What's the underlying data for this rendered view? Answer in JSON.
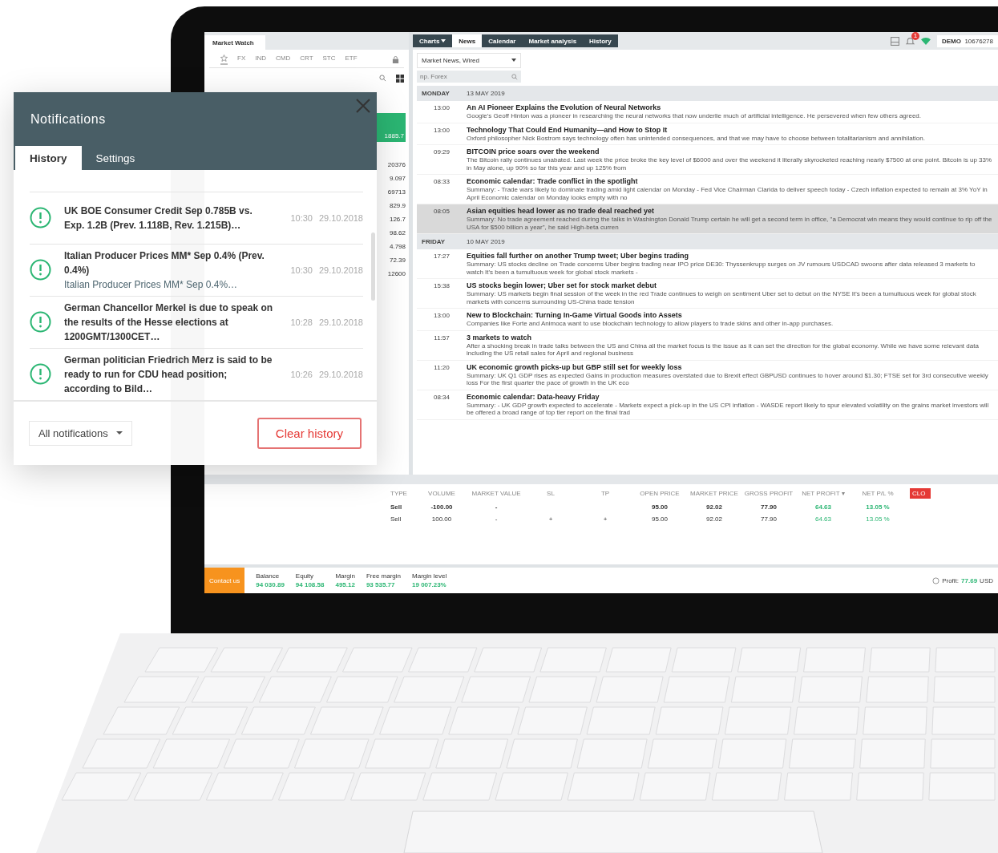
{
  "market_watch": {
    "tab": "Market Watch",
    "categories": [
      {
        "kind": "star",
        "selected": true
      },
      {
        "kind": "text",
        "label": "FX",
        "selected": false
      },
      {
        "kind": "text",
        "label": "IND",
        "selected": false
      },
      {
        "kind": "text",
        "label": "CMD",
        "selected": false
      },
      {
        "kind": "text",
        "label": "CRT",
        "selected": false
      },
      {
        "kind": "text",
        "label": "STC",
        "selected": false
      },
      {
        "kind": "text",
        "label": "ETF",
        "selected": false
      }
    ],
    "buy_price": "1885.7",
    "prices": [
      "20376",
      "9.097",
      "69713",
      "829.9",
      "126.7",
      "98.62",
      "4.798",
      "72.39",
      "12600"
    ]
  },
  "top_tabs": [
    {
      "label": "Charts",
      "dropdown": true,
      "selected": false
    },
    {
      "label": "News",
      "dropdown": false,
      "selected": true
    },
    {
      "label": "Calendar",
      "dropdown": false,
      "selected": false
    },
    {
      "label": "Market analysis",
      "dropdown": false,
      "selected": false
    },
    {
      "label": "History",
      "dropdown": false,
      "selected": false
    }
  ],
  "account": {
    "notification_count": "1",
    "mode": "DEMO",
    "number": "10676278"
  },
  "news": {
    "source_filter": "Market News, Wired",
    "search": {
      "placeholder": "np. Forex"
    },
    "days": [
      {
        "weekday": "MONDAY",
        "date": "13 MAY 2019",
        "items": [
          {
            "time": "13:00",
            "title": "An AI Pioneer Explains the Evolution of Neural Networks",
            "summary": "Google's Geoff Hinton was a pioneer in researching the neural networks that now underlie much of artificial intelligence. He persevered when few others agreed.",
            "selected": false
          },
          {
            "time": "13:00",
            "title": "Technology That Could End Humanity—and How to Stop It",
            "summary": "Oxford philosopher Nick Bostrom says technology often has unintended consequences, and that we may have to choose between totalitarianism and annihilation.",
            "selected": false
          },
          {
            "time": "09:29",
            "title": "BITCOIN price soars over the weekend",
            "summary": "The Bitcoin rally continues unabated. Last week the price broke the key level of $6000 and over the weekend it literally skyrocketed reaching nearly $7500 at one point. Bitcoin is up 33% in May alone, up 90% so far this year and up 125% from",
            "selected": false
          },
          {
            "time": "08:33",
            "title": "Economic calendar: Trade conflict in the spotlight",
            "summary": "Summary: - Trade wars likely to dominate trading amid light calendar on Monday - Fed Vice Chairman Clarida to deliver speech today - Czech inflation expected to remain at 3% YoY in April Economic calendar on Monday looks empty with no",
            "selected": false
          },
          {
            "time": "08:05",
            "title": "Asian equities head lower as no trade deal reached yet",
            "summary": "Summary: No trade agreement reached during the talks in Washington Donald Trump certain he will get a second term in office, \"a Democrat win means they would continue to rip off the USA for $500 billion a year\", he said High-beta curren",
            "selected": true
          }
        ]
      },
      {
        "weekday": "FRIDAY",
        "date": "10 MAY 2019",
        "items": [
          {
            "time": "17:27",
            "title": "Equities fall further on another Trump tweet; Uber begins trading",
            "summary": "Summary: US stocks decline on Trade concerns Uber begins trading near IPO price DE30: Thyssenkrupp surges on JV rumours USDCAD swoons after data released 3 markets to watch   It's been a tumultuous week for global stock markets -",
            "selected": false
          },
          {
            "time": "15:38",
            "title": "US stocks begin lower; Uber set for stock market debut",
            "summary": "Summary: US markets begin final session of the week in the red Trade continues to weigh on sentiment Uber set to debut on the NYSE   It's been a tumultuous week for global stock markets with concerns surrounding US-China trade tension",
            "selected": false
          },
          {
            "time": "13:00",
            "title": "New to Blockchain: Turning In-Game Virtual Goods into Assets",
            "summary": "Companies like Forte and Animoca want to use blockchain technology to allow players to trade skins and other in-app purchases.",
            "selected": false
          },
          {
            "time": "11:57",
            "title": "3 markets to watch",
            "summary": "After a shocking break in trade talks between the US and China all the market focus is the issue as it can set the direction for the global economy. While we have some relevant data including the US retail sales for April and regional business",
            "selected": false
          },
          {
            "time": "11:20",
            "title": "UK economic growth picks-up but GBP still set for weekly loss",
            "summary": "Summary: UK Q1 GDP rises as expected Gains in production measures overstated due to Brexit effect GBPUSD continues to hover around $1.30; FTSE set for 3rd consecutive weekly loss For the first quarter the pace of growth in the UK eco",
            "selected": false
          },
          {
            "time": "08:34",
            "title": "Economic calendar: Data-heavy Friday",
            "summary": "Summary: - UK GDP growth expected to accelerate - Markets expect a pick-up in the US CPI inflation - WASDE report likely to spur elevated volatility on the grains market investors will be offered a broad range of top tier report on the final trad",
            "selected": false
          }
        ]
      }
    ]
  },
  "positions": {
    "columns": [
      {
        "label": "TYPE",
        "kind": "plain"
      },
      {
        "label": "VOLUME",
        "kind": "plain"
      },
      {
        "label": "MARKET VALUE",
        "kind": "plain"
      },
      {
        "label": "SL",
        "kind": "plain"
      },
      {
        "label": "TP",
        "kind": "plain"
      },
      {
        "label": "OPEN PRICE",
        "kind": "plain"
      },
      {
        "label": "MARKET PRICE",
        "kind": "plain"
      },
      {
        "label": "GROSS PROFIT",
        "kind": "plain"
      },
      {
        "label": "NET PROFIT ▾",
        "kind": "profit"
      },
      {
        "label": "NET P/L %",
        "kind": "profit"
      }
    ],
    "close_button": "CLO",
    "rows": [
      {
        "kind": "summary",
        "cells": [
          "Sell",
          "-100.00",
          "-",
          "",
          "",
          "95.00",
          "92.02",
          "77.90",
          "64.63",
          "13.05 %"
        ]
      },
      {
        "kind": "detail",
        "cells": [
          "Sell",
          "100.00",
          "-",
          "+",
          "+",
          "95.00",
          "92.02",
          "77.90",
          "64.63",
          "13.05 %"
        ]
      }
    ]
  },
  "footer": {
    "contact": "Contact us",
    "stats": [
      {
        "label": "Balance",
        "value": "94 030.89"
      },
      {
        "label": "Equity",
        "value": "94 108.58"
      },
      {
        "label": "Margin",
        "value": "495.12"
      },
      {
        "label": "Free margin",
        "value": "93 535.77"
      },
      {
        "label": "Margin level",
        "value": "19 007.23%"
      }
    ],
    "profit_label": "Profit:",
    "profit_value": "77.69",
    "currency": "USD"
  },
  "notifications": {
    "title": "Notifications",
    "tabs": [
      {
        "label": "History",
        "selected": true
      },
      {
        "label": "Settings",
        "selected": false
      }
    ],
    "items": [
      {
        "title": "UK BOE Consumer Credit Sep 0.785B vs. Exp. 1.2B (Prev. 1.118B, Rev. 1.215B)…",
        "time": "10:30",
        "date": "29.10.2018"
      },
      {
        "title": "Italian Producer Prices MM* Sep 0.4% (Prev. 0.4%)",
        "subtitle": "Italian Producer Prices MM* Sep 0.4%…",
        "time": "10:30",
        "date": "29.10.2018"
      },
      {
        "title": "German Chancellor Merkel is due to speak on the results of the Hesse elections at 1200GMT/1300CET…",
        "time": "10:28",
        "date": "29.10.2018"
      },
      {
        "title": "German politician Friedrich Merz is said to be ready to run for CDU head position; according to Bild…",
        "time": "10:26",
        "date": "29.10.2018"
      }
    ],
    "filter": "All notifications",
    "clear_button": "Clear history"
  }
}
